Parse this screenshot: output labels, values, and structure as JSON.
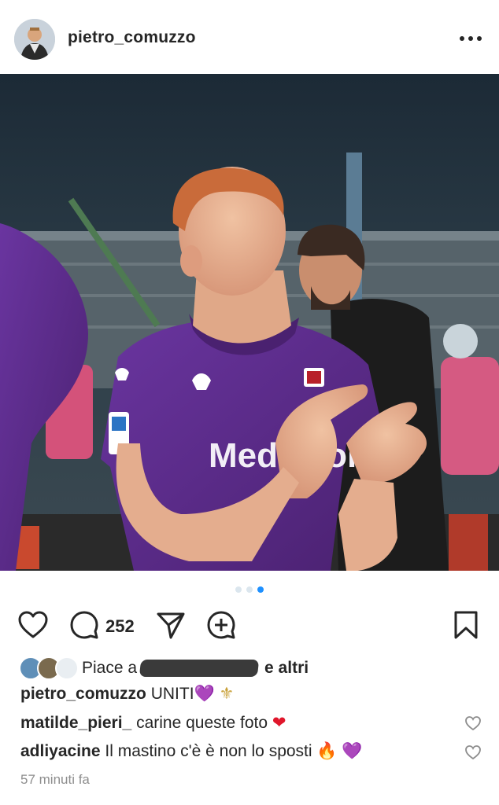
{
  "post": {
    "username": "pietro_comuzzo",
    "more_icon": "more-horizontal-icon"
  },
  "photo": {
    "jersey_text": "Mediacom"
  },
  "carousel": {
    "total": 3,
    "active_index": 2
  },
  "actions": {
    "comment_count": "252"
  },
  "likes": {
    "prefix": "Piace a",
    "suffix": "e altri"
  },
  "caption": {
    "username": "pietro_comuzzo",
    "text": "UNITI"
  },
  "comments": [
    {
      "username": "matilde_pieri_",
      "text": "carine queste foto"
    },
    {
      "username": "adliyacine",
      "text": "Il mastino c'è è non lo sposti"
    }
  ],
  "timestamp": "57 minuti fa",
  "colors": {
    "accent": "#1e90ff",
    "text": "#262626",
    "muted": "#8e8e8e",
    "fiorentina_purple": "#5b2a86"
  }
}
